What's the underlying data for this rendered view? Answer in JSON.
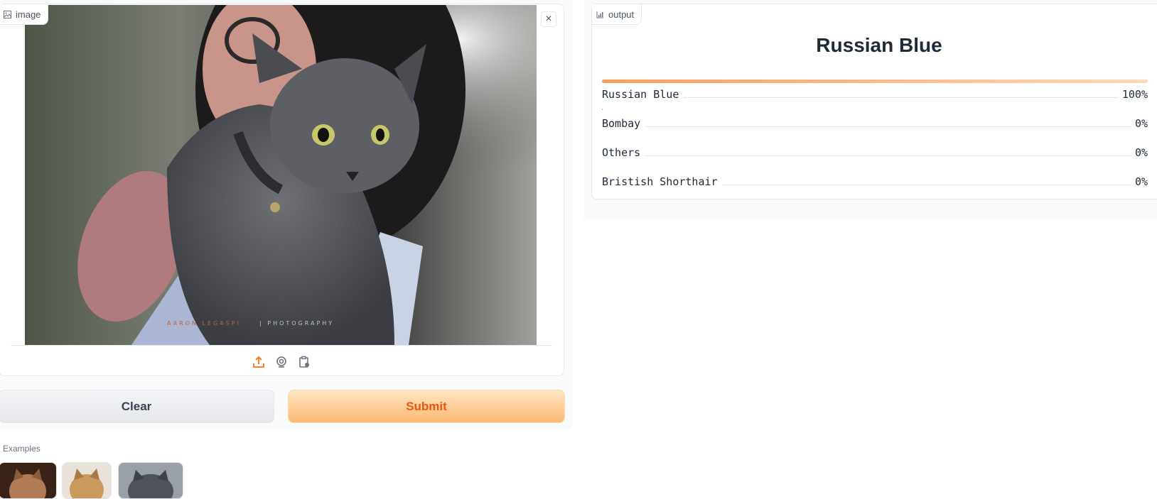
{
  "input": {
    "panel_label": "image",
    "close_symbol": "×",
    "icons": [
      "upload-icon",
      "webcam-icon",
      "clipboard-icon"
    ],
    "clear_label": "Clear",
    "submit_label": "Submit"
  },
  "examples": {
    "label": "Examples",
    "items": [
      "example-1",
      "example-2",
      "example-3"
    ]
  },
  "output": {
    "panel_label": "output",
    "title": "Russian Blue",
    "confidences": [
      {
        "label": "Russian Blue",
        "value": "100%",
        "fraction": 1.0
      },
      {
        "label": "Bombay",
        "value": "0%",
        "fraction": 0.0
      },
      {
        "label": "Others",
        "value": "0%",
        "fraction": 0.0
      },
      {
        "label": "Bristish Shorthair",
        "value": "0%",
        "fraction": 0.0
      }
    ]
  },
  "colors": {
    "accent": "#f97316",
    "submit_text": "#ea580c",
    "submit_bg": "#fdba74",
    "clear_bg": "#e5e7eb"
  }
}
